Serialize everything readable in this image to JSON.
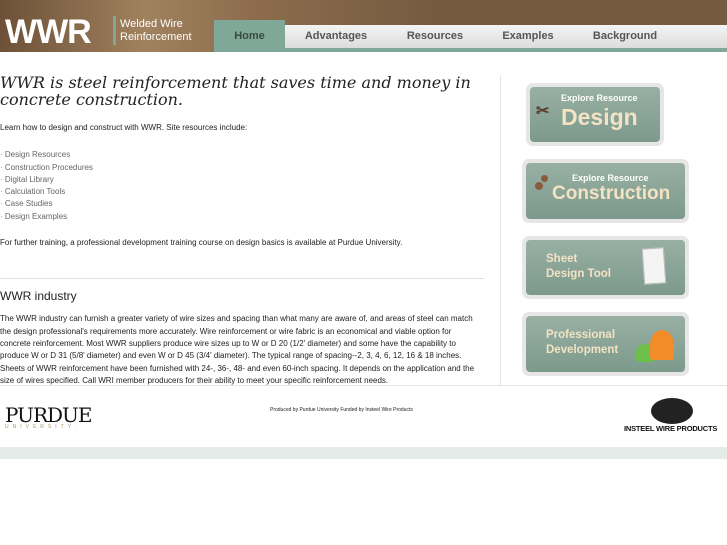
{
  "header": {
    "logo": "WWR",
    "subtitle_line1": "Welded Wire",
    "subtitle_line2": "Reinforcement"
  },
  "nav": [
    "Home",
    "Advantages",
    "Resources",
    "Examples",
    "Background"
  ],
  "main": {
    "headline": "WWR is steel reinforcement that saves time and money in concrete construction.",
    "intro": "Learn how to design and construct with WWR. Site resources include:",
    "resources": [
      "Design Resources",
      "Construction Procedures",
      "Digital Library",
      "Calculation Tools",
      "Case Studies",
      "Design Examples"
    ],
    "training": "For further training, a professional development training course on design basics is available at Purdue University.",
    "industry_title": "WWR industry",
    "industry_text": "The WWR industry can furnish a greater variety of wire sizes and spacing than what many are aware of, and areas of steel can match the design professional's requirements more accurately. Wire reinforcement or wire fabric is an economical and viable option for concrete reinforcement. Most WWR suppliers produce wire sizes up to W or D 20 (1/2' diameter) and some have the capability to produce W or D 31 (5/8' diameter) and even W or D 45 (3/4' diameter). The typical range of spacing--2, 3, 4, 6, 12, 16 & 18 inches. Sheets of WWR reinforcement have been furnished with 24-, 36-, 48- and even 60-inch spacing. It depends on the application and the size of wires specified. Call WRI member producers for their ability to meet your specific reinforcement needs."
  },
  "sidebar": {
    "design": {
      "small": "Explore Resource",
      "big": "Design"
    },
    "construction": {
      "small": "Explore Resource",
      "big": "Construction"
    },
    "sheet": {
      "line1": "Sheet",
      "line2": "Design Tool"
    },
    "professional": {
      "line1": "Professional",
      "line2": "Development"
    }
  },
  "footer": {
    "purdue": "PURDUE",
    "purdue_sub": "UNIVERSITY.",
    "credit": "Produced by Purdue University Funded by Insteel Wire Products",
    "insteel": "INSTEEL WIRE PRODUCTS"
  }
}
